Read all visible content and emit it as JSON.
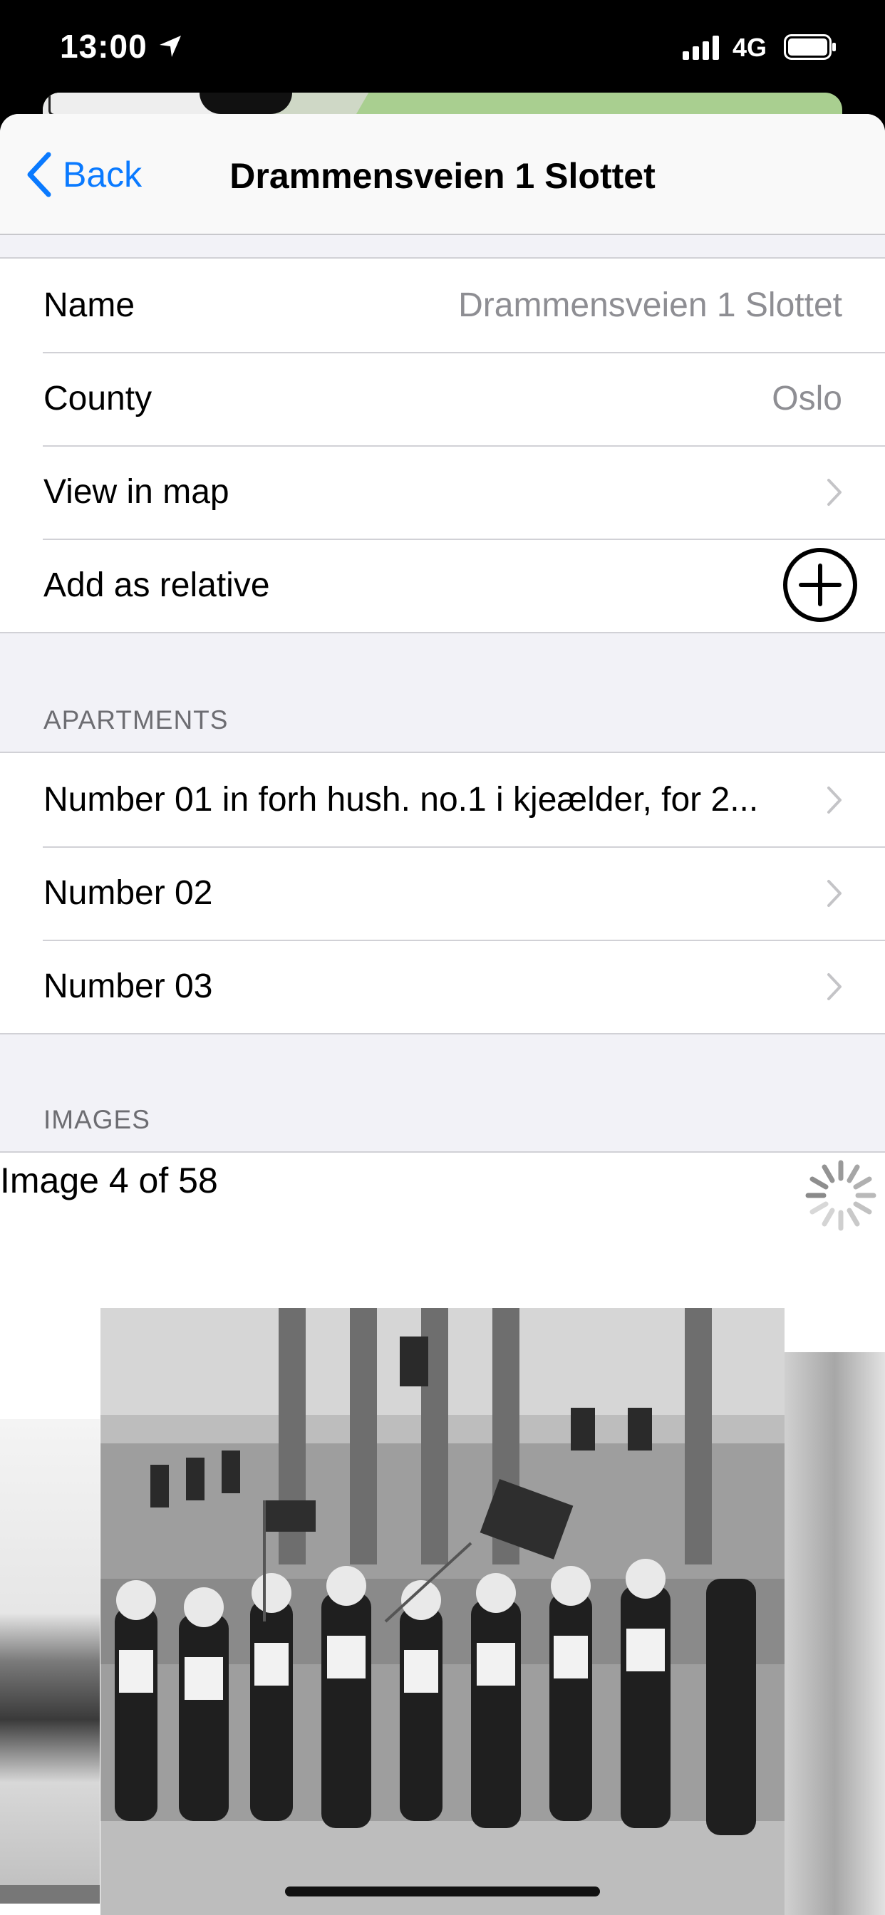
{
  "status_bar": {
    "time": "13:00",
    "network": "4G",
    "icons": [
      "location-arrow-icon",
      "cellular-signal-icon",
      "battery-icon"
    ]
  },
  "nav": {
    "back_label": "Back",
    "title": "Drammensveien 1 Slottet"
  },
  "details": {
    "rows": [
      {
        "label": "Name",
        "value": "Drammensveien 1 Slottet"
      },
      {
        "label": "County",
        "value": "Oslo"
      },
      {
        "label": "View in map"
      },
      {
        "label": "Add as relative"
      }
    ]
  },
  "apartments": {
    "header": "APARTMENTS",
    "rows": [
      {
        "label": "Number 01 in forh hush. no.1 i kjeælder, for 2..."
      },
      {
        "label": "Number 02"
      },
      {
        "label": "Number 03"
      }
    ]
  },
  "images": {
    "header": "IMAGES",
    "counter": "Image 4 of 58",
    "carousel": [
      "winter-house-photo",
      "palace-parade-photo",
      "palace-facade-photo"
    ]
  },
  "colors": {
    "accent": "#0a7aff",
    "secondary_text": "#8e8e93",
    "section_text": "#6d6d72",
    "grouped_background": "#f2f2f7"
  }
}
